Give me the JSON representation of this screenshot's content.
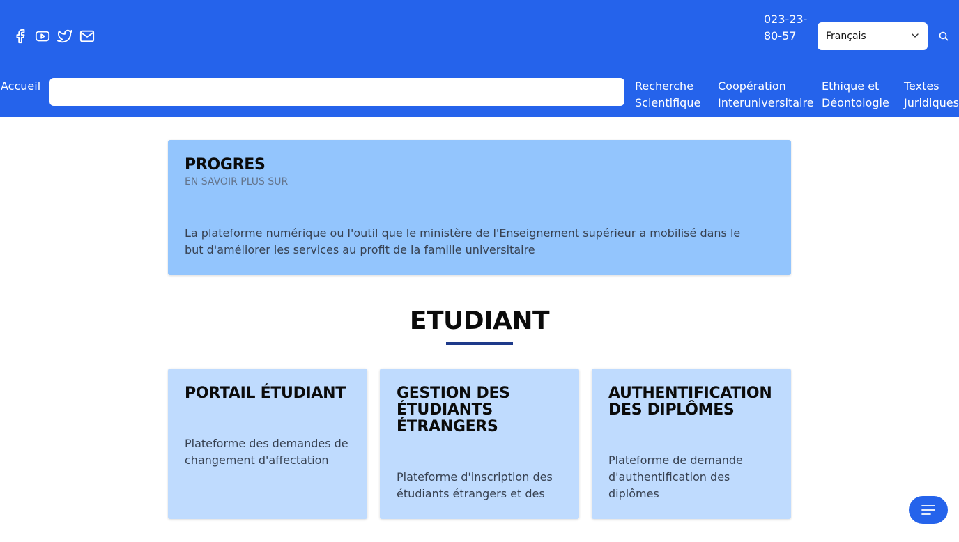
{
  "header": {
    "social": [
      {
        "name": "facebook-icon"
      },
      {
        "name": "youtube-icon"
      },
      {
        "name": "twitter-icon"
      },
      {
        "name": "mail-icon"
      }
    ],
    "phone": "023-23-80-57",
    "language": {
      "selected": "Français"
    },
    "search_icon": "search-icon",
    "background": "#2563eb"
  },
  "nav": {
    "home": "Accueil",
    "search_value": "",
    "items": [
      "Recherche Scientifique",
      "Coopération Interuniversitaire",
      "Ethique et Déontologie",
      "Textes Juridiques"
    ]
  },
  "main_card": {
    "title": "PROGRES",
    "subtitle": "EN SAVOIR PLUS SUR",
    "text": "La plateforme numérique ou l'outil que le ministère de l'Enseignement supérieur a mobilisé dans le but d'améliorer les services au profit de la famille universitaire",
    "color": "#93c5fd"
  },
  "section": {
    "title": "ETUDIANT",
    "underline_color": "#1e3a8a"
  },
  "cards": [
    {
      "title": "PORTAIL ÉTUDIANT",
      "text": "Plateforme des demandes de changement d'affectation"
    },
    {
      "title": "GESTION DES ÉTUDIANTS ÉTRANGERS",
      "text": "Plateforme d'inscription des étudiants étrangers et des"
    },
    {
      "title": "AUTHENTIFICATION DES DIPLÔMES",
      "text": "Plateforme de demande d'authentification des diplômes"
    }
  ],
  "fab": {
    "icon": "menu-icon"
  }
}
